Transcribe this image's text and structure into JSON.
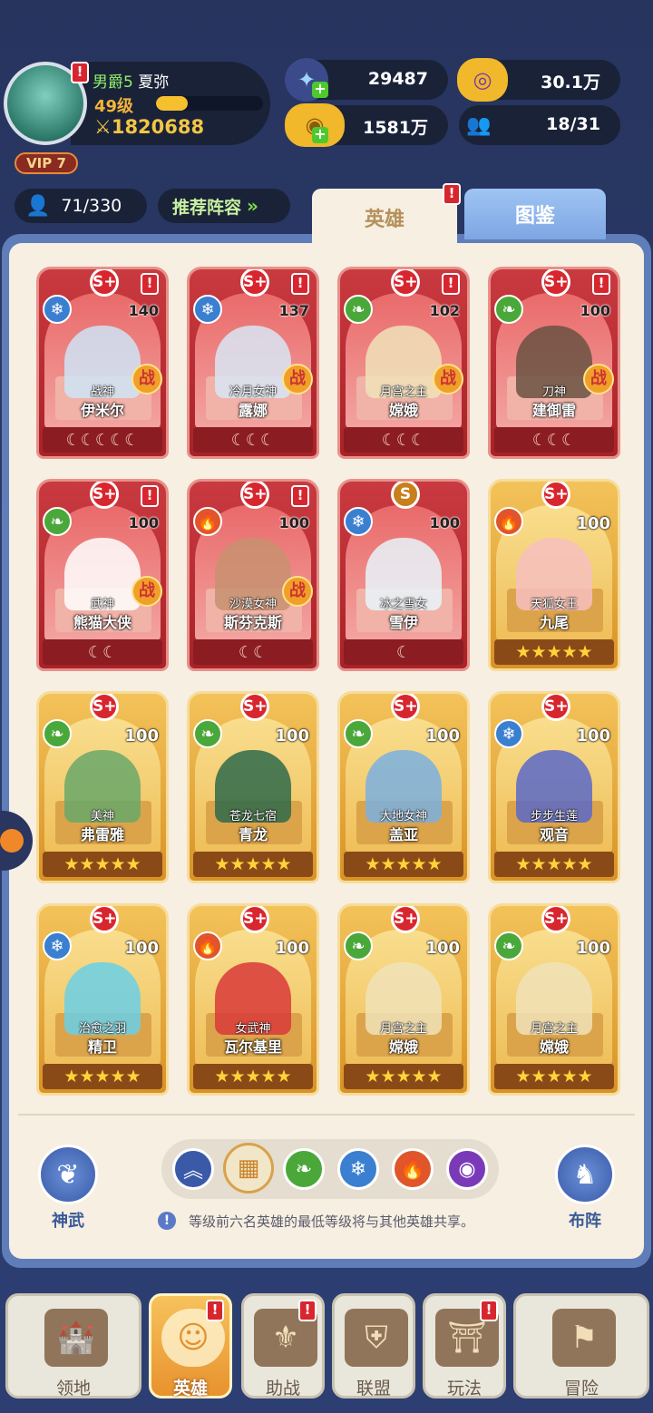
{
  "player": {
    "title": "男爵5",
    "name": "夏弥",
    "level": "49级",
    "xp_fraction": 0.3,
    "power": "1820688",
    "vip": "VIP 7"
  },
  "resources": {
    "diamonds": "29487",
    "gold": "1581万",
    "gems": "30.1万",
    "friends": "18/31"
  },
  "hero_count": "71/330",
  "recommend_label": "推荐阵容",
  "tabs": {
    "heroes": "英雄",
    "codex": "图鉴"
  },
  "cards": [
    {
      "frame": "red",
      "grade": "S+",
      "elem": "ice",
      "level": "140",
      "title": "战神",
      "name": "伊米尔",
      "battle": "战",
      "moons": "☾☾☾☾☾",
      "alert": true
    },
    {
      "frame": "red",
      "grade": "S+",
      "elem": "ice",
      "level": "137",
      "title": "冷月女神",
      "name": "露娜",
      "battle": "战",
      "moons": "☾☾☾",
      "alert": true
    },
    {
      "frame": "red",
      "grade": "S+",
      "elem": "nat",
      "level": "102",
      "title": "月宫之主",
      "name": "嫦娥",
      "battle": "战",
      "moons": "☾☾☾",
      "alert": true
    },
    {
      "frame": "red",
      "grade": "S+",
      "elem": "nat",
      "level": "100",
      "title": "刀神",
      "name": "建御雷",
      "battle": "战",
      "moons": "☾☾☾",
      "alert": true
    },
    {
      "frame": "red",
      "grade": "S+",
      "elem": "nat",
      "level": "100",
      "title": "武神",
      "name": "熊猫大侠",
      "battle": "战",
      "moons": "☾☾",
      "alert": true
    },
    {
      "frame": "red",
      "grade": "S+",
      "elem": "fire",
      "level": "100",
      "title": "沙漠女神",
      "name": "斯芬克斯",
      "battle": "战",
      "moons": "☾☾",
      "alert": true
    },
    {
      "frame": "red",
      "grade": "S",
      "elem": "ice",
      "level": "100",
      "title": "冰之雪女",
      "name": "雪伊",
      "battle": "",
      "moons": "☾",
      "alert": false
    },
    {
      "frame": "gold",
      "grade": "S+",
      "elem": "fire",
      "level": "100",
      "title": "天狐女王",
      "name": "九尾",
      "battle": "",
      "moons": "★★★★★",
      "alert": false
    },
    {
      "frame": "gold",
      "grade": "S+",
      "elem": "nat",
      "level": "100",
      "title": "美神",
      "name": "弗雷雅",
      "battle": "",
      "moons": "★★★★★",
      "alert": false
    },
    {
      "frame": "gold",
      "grade": "S+",
      "elem": "nat",
      "level": "100",
      "title": "苍龙七宿",
      "name": "青龙",
      "battle": "",
      "moons": "★★★★★",
      "alert": false
    },
    {
      "frame": "gold",
      "grade": "S+",
      "elem": "nat",
      "level": "100",
      "title": "大地女神",
      "name": "盖亚",
      "battle": "",
      "moons": "★★★★★",
      "alert": false
    },
    {
      "frame": "gold",
      "grade": "S+",
      "elem": "ice",
      "level": "100",
      "title": "步步生莲",
      "name": "观音",
      "battle": "",
      "moons": "★★★★★",
      "alert": false
    },
    {
      "frame": "gold",
      "grade": "S+",
      "elem": "ice",
      "level": "100",
      "title": "治愈之羽",
      "name": "精卫",
      "battle": "",
      "moons": "★★★★★",
      "alert": false
    },
    {
      "frame": "gold",
      "grade": "S+",
      "elem": "fire",
      "level": "100",
      "title": "女武神",
      "name": "瓦尔基里",
      "battle": "",
      "moons": "★★★★★",
      "alert": false
    },
    {
      "frame": "gold",
      "grade": "S+",
      "elem": "nat",
      "level": "100",
      "title": "月宫之主",
      "name": "嫦娥",
      "battle": "",
      "moons": "★★★★★",
      "alert": false
    },
    {
      "frame": "gold",
      "grade": "S+",
      "elem": "nat",
      "level": "100",
      "title": "月宫之主",
      "name": "嫦娥",
      "battle": "",
      "moons": "★★★★★",
      "alert": false
    }
  ],
  "side_buttons": {
    "weapon": "神武",
    "formation": "布阵"
  },
  "info_text": "等级前六名英雄的最低等级将与其他英雄共享。",
  "nav": [
    {
      "label": "领地",
      "icon": "castle-icon",
      "alert": false
    },
    {
      "label": "英雄",
      "icon": "hero-icon",
      "alert": true
    },
    {
      "label": "助战",
      "icon": "banner-icon",
      "alert": true
    },
    {
      "label": "联盟",
      "icon": "shield-icon",
      "alert": false
    },
    {
      "label": "玩法",
      "icon": "gate-icon",
      "alert": true
    },
    {
      "label": "冒险",
      "icon": "map-icon",
      "alert": false
    }
  ]
}
